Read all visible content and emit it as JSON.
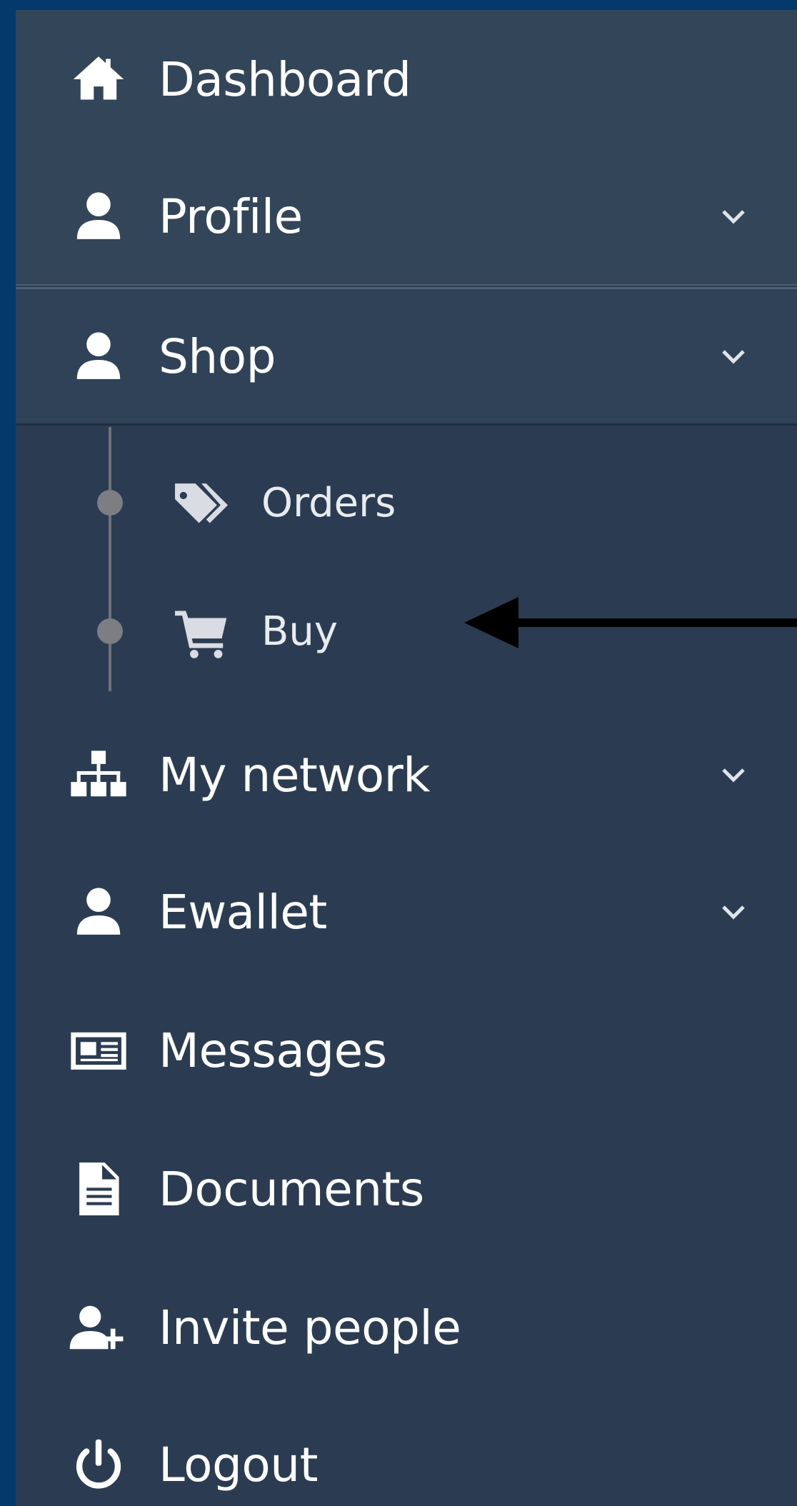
{
  "nav": {
    "items": [
      {
        "label": "Dashboard",
        "icon": "home-icon",
        "has_submenu": false
      },
      {
        "label": "Profile",
        "icon": "user-icon",
        "has_submenu": true
      },
      {
        "label": "Shop",
        "icon": "user-icon",
        "has_submenu": true,
        "expanded": true
      },
      {
        "label": "My network",
        "icon": "sitemap-icon",
        "has_submenu": true
      },
      {
        "label": "Ewallet",
        "icon": "user-icon",
        "has_submenu": true
      },
      {
        "label": "Messages",
        "icon": "newspaper-icon",
        "has_submenu": false
      },
      {
        "label": "Documents",
        "icon": "file-text-icon",
        "has_submenu": false
      },
      {
        "label": "Invite people",
        "icon": "user-plus-icon",
        "has_submenu": false
      },
      {
        "label": "Logout",
        "icon": "power-icon",
        "has_submenu": false
      }
    ],
    "shop_submenu": [
      {
        "label": "Orders",
        "icon": "tags-icon"
      },
      {
        "label": "Buy",
        "icon": "cart-icon"
      }
    ]
  },
  "annotation": {
    "type": "arrow",
    "points_to": "Buy"
  },
  "colors": {
    "background": "#033a6b",
    "sidebar": "#2b3c52",
    "sidebar_light": "#334559",
    "text": "#ffffff"
  }
}
